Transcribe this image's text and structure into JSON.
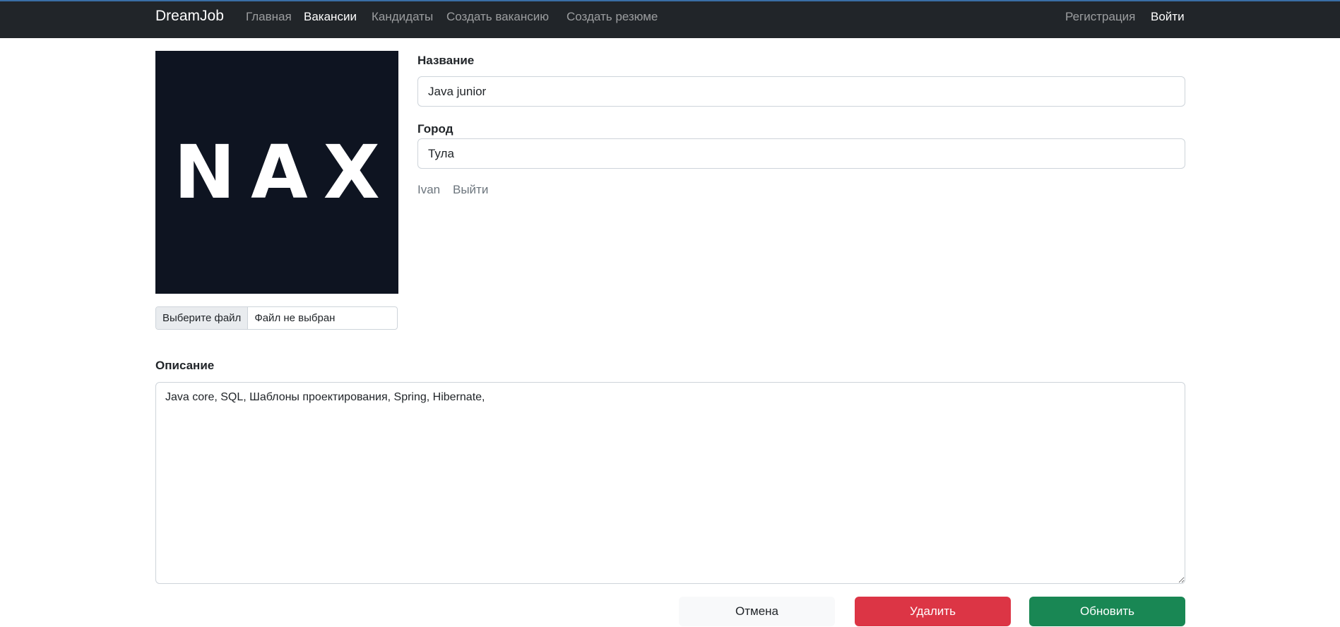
{
  "nav": {
    "brand": "DreamJob",
    "links": [
      "Главная",
      "Вакансии",
      "Кандидаты",
      "Создать вакансию",
      "Создать резюме"
    ],
    "active_index": 1,
    "register": "Регистрация",
    "login": "Войти"
  },
  "photo": {
    "logo_text": "NAX",
    "background": "#0e1421"
  },
  "file_input": {
    "button_label": "Выберите файл",
    "status": "Файл не выбран"
  },
  "form": {
    "title_label": "Название",
    "title_value": "Java junior",
    "city_label": "Город",
    "city_value": "Тула",
    "description_label": "Описание",
    "description_value": "Java core, SQL, Шаблоны проектирования, Spring, Hibernate,"
  },
  "user": {
    "name": "Ivan",
    "logout": "Выйти"
  },
  "buttons": {
    "cancel": "Отмена",
    "delete": "Удалить",
    "update": "Обновить"
  },
  "colors": {
    "navbar": "#212529",
    "delete": "#dc3545",
    "update": "#198754"
  }
}
